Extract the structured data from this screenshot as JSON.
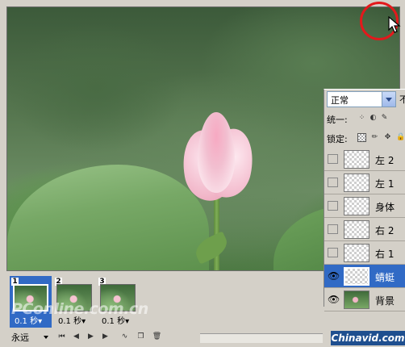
{
  "layers_panel": {
    "blend_mode": "正常",
    "opacity_label": "不",
    "unify_label": "统一:",
    "lock_label": "锁定:",
    "layers": [
      {
        "name": "左 2",
        "visible": false,
        "selected": false,
        "photo": false
      },
      {
        "name": "左 1",
        "visible": false,
        "selected": false,
        "photo": false
      },
      {
        "name": "身体",
        "visible": false,
        "selected": false,
        "photo": false
      },
      {
        "name": "右 2",
        "visible": false,
        "selected": false,
        "photo": false
      },
      {
        "name": "右 1",
        "visible": false,
        "selected": false,
        "photo": false
      },
      {
        "name": "蜻蜓",
        "visible": true,
        "selected": true,
        "photo": false
      },
      {
        "name": "背景",
        "visible": true,
        "selected": false,
        "photo": true
      }
    ]
  },
  "animation": {
    "frames": [
      {
        "number": "1",
        "delay": "0.1 秒▾",
        "selected": true
      },
      {
        "number": "2",
        "delay": "0.1 秒▾",
        "selected": false
      },
      {
        "number": "3",
        "delay": "0.1 秒▾",
        "selected": false
      }
    ],
    "loop_label": "永远"
  },
  "watermarks": {
    "left": "PConline.com.cn",
    "right": "Chinavid.com"
  },
  "colors": {
    "highlight_circle": "#e3191c",
    "selection": "#316ac5"
  }
}
